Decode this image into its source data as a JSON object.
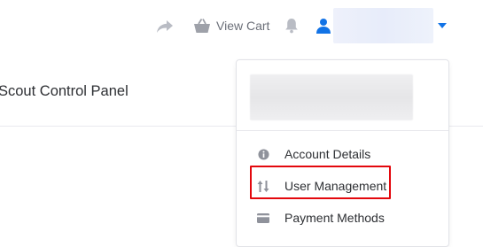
{
  "topbar": {
    "icons": {
      "share": "share-arrow-icon",
      "cart": "basket-icon",
      "bell": "bell-icon",
      "user": "user-icon",
      "caret": "caret-down-icon"
    },
    "view_cart_label": "View Cart",
    "user_name": ""
  },
  "page": {
    "title": "Scout Control Panel"
  },
  "user_menu": {
    "items": [
      {
        "label": "Account Details",
        "icon": "info-circle-icon"
      },
      {
        "label": "User Management",
        "icon": "sort-arrows-icon"
      },
      {
        "label": "Payment Methods",
        "icon": "credit-card-icon"
      }
    ]
  },
  "colors": {
    "accent": "#1273e6",
    "icon_gray": "#b9bcc4",
    "highlight": "#e3080d"
  }
}
